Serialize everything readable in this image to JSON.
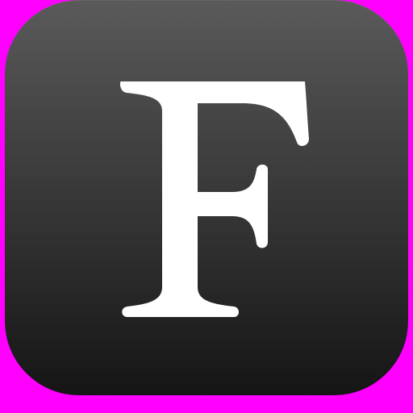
{
  "app_icon": {
    "glyph": "F",
    "icon_name": "font-letter-f-icon"
  },
  "colors": {
    "background": "#ff00ff",
    "tile_top": "#5a5a5a",
    "tile_bottom": "#151515",
    "glyph": "#ffffff"
  }
}
